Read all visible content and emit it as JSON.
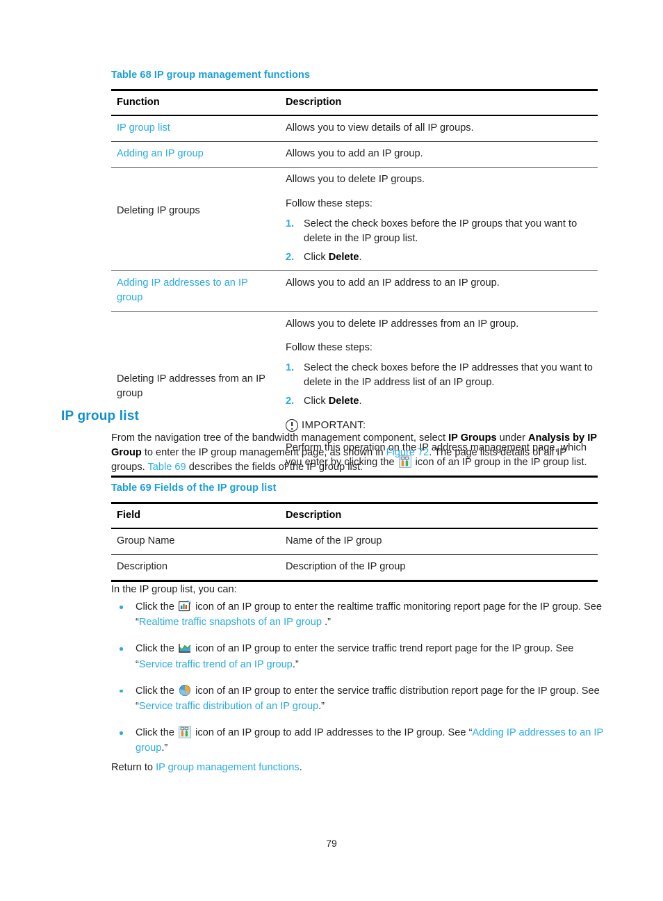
{
  "table68": {
    "caption": "Table 68 IP group management functions",
    "headers": [
      "Function",
      "Description"
    ],
    "rows": [
      {
        "function": "IP group list",
        "function_is_link": true,
        "description_intro": "Allows you to view details of all IP groups."
      },
      {
        "function": "Adding an IP group",
        "function_is_link": true,
        "description_intro": "Allows you to add an IP group."
      },
      {
        "function": "Deleting IP groups",
        "function_is_link": false,
        "description_intro": "Allows you to delete IP groups.",
        "follow_label": "Follow these steps:",
        "steps": [
          {
            "num": "1.",
            "text_pre": "Select the check boxes before the IP groups that you want to delete in the IP group list.",
            "bold": "",
            "text_post": ""
          },
          {
            "num": "2.",
            "text_pre": "Click ",
            "bold": "Delete",
            "text_post": "."
          }
        ]
      },
      {
        "function": "Adding IP addresses to an IP group",
        "function_is_link": true,
        "description_intro": "Allows you to add an IP address to an IP group."
      },
      {
        "function": "Deleting IP addresses from an IP group",
        "function_is_link": false,
        "description_intro": "Allows you to delete IP addresses from an IP group.",
        "follow_label": "Follow these steps:",
        "steps": [
          {
            "num": "1.",
            "text_pre": "Select the check boxes before the IP addresses that you want to delete in the IP address list of an IP group.",
            "bold": "",
            "text_post": ""
          },
          {
            "num": "2.",
            "text_pre": "Click ",
            "bold": "Delete",
            "text_post": "."
          }
        ],
        "important_label": "IMPORTANT:",
        "important_text_pre": "Perform this operation on the IP address management page, which you enter by clicking the ",
        "important_icon": "two-people-icon",
        "important_text_post": " icon of an IP group in the IP group list."
      }
    ]
  },
  "section": {
    "heading": "IP group list",
    "intro_pre": "From the navigation tree of the bandwidth management component, select ",
    "intro_bold1": "IP Groups",
    "intro_mid1": " under ",
    "intro_bold2": "Analysis by IP Group",
    "intro_mid2": " to enter the IP group management page, as shown in ",
    "intro_link1": "Figure 72",
    "intro_mid3": ". The page lists details of all IP groups. ",
    "intro_link2": "Table 69",
    "intro_post": " describes the fields of the IP group list."
  },
  "table69": {
    "caption": "Table 69 Fields of the IP group list",
    "headers": [
      "Field",
      "Description"
    ],
    "rows": [
      {
        "field": "Group Name",
        "description": "Name of the IP group"
      },
      {
        "field": "Description",
        "description": "Description of the IP group"
      }
    ]
  },
  "list_intro": "In the IP group list, you can:",
  "bullets": [
    {
      "pre": "Click the ",
      "icon": "bar-chart-report-icon",
      "mid": " icon of an IP group to enter the realtime traffic monitoring report page for the IP group. See “",
      "link": "Realtime traffic snapshots of an IP group ",
      "post": ".”"
    },
    {
      "pre": "Click the ",
      "icon": "area-chart-trend-icon",
      "mid": " icon of an IP group to enter the service traffic trend report page for the IP group. See “",
      "link": "Service traffic trend of an IP group",
      "post": ".”"
    },
    {
      "pre": "Click the ",
      "icon": "pie-chart-distribution-icon",
      "mid": " icon of an IP group to enter the service traffic distribution report page for the IP group. See “",
      "link": "Service traffic distribution of an IP group",
      "post": ".”"
    },
    {
      "pre": "Click the ",
      "icon": "two-people-icon",
      "mid": " icon of an IP group to add IP addresses to the IP group. See “",
      "link": "Adding IP addresses to an IP group",
      "post": ".”"
    }
  ],
  "return_line": {
    "pre": "Return to ",
    "link": "IP group management functions",
    "post": "."
  },
  "page_number": "79",
  "colors": {
    "link": "#29abe2",
    "heading": "#0e8fce",
    "caption": "#1a9fd9",
    "text": "#231f20"
  }
}
